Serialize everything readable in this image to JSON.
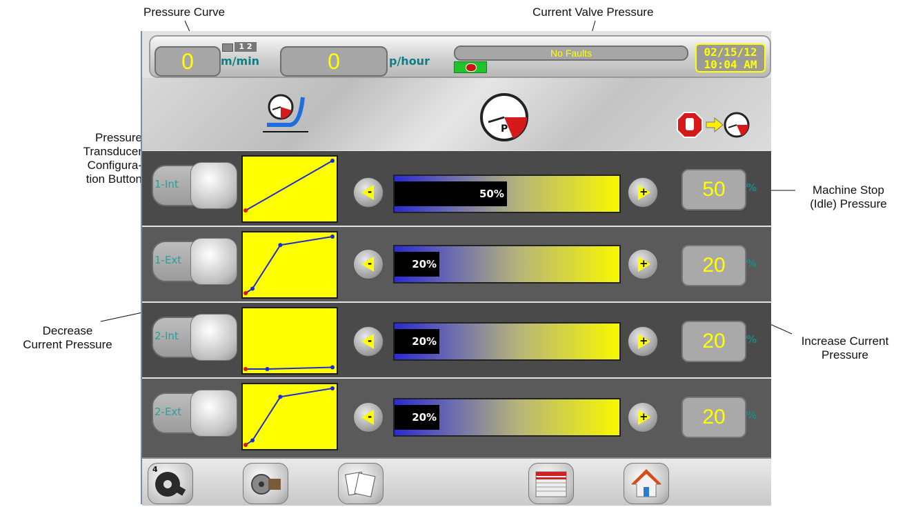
{
  "callouts": {
    "pressure_curve": "Pressure Curve",
    "current_valve_pressure": "Current Valve Pressure",
    "pressure_transducer": [
      "Pressure",
      "Transducer",
      "Configura-",
      "tion Button"
    ],
    "machine_stop": [
      "Machine Stop",
      "(Idle) Pressure"
    ],
    "decrease": [
      "Decrease",
      "Current Pressure"
    ],
    "increase": [
      "Increase Current",
      "Pressure"
    ]
  },
  "header": {
    "speed_value": "0",
    "speed_unit": "m/min",
    "line_indicator": "1 2",
    "rate_value": "0",
    "rate_unit": "p/hour",
    "fault_text": "No Faults",
    "date": "02/15/12",
    "time": "10:04 AM"
  },
  "column_icons": {
    "curve": "pressure-curve-icon",
    "gauge": "pressure-gauge-icon",
    "stop": "stop-to-gauge-icon"
  },
  "rows": [
    {
      "label": "1-Int",
      "percent": 50,
      "percent_label": "50%",
      "idle_value": "50",
      "idle_unit": "%",
      "curve_points": [
        [
          0,
          0.12
        ],
        [
          1,
          1.0
        ]
      ]
    },
    {
      "label": "1-Ext",
      "percent": 20,
      "percent_label": "20%",
      "idle_value": "20",
      "idle_unit": "%",
      "curve_points": [
        [
          0,
          0.0
        ],
        [
          0.08,
          0.08
        ],
        [
          0.4,
          0.85
        ],
        [
          1,
          1.0
        ]
      ]
    },
    {
      "label": "2-Int",
      "percent": 20,
      "percent_label": "20%",
      "idle_value": "20",
      "idle_unit": "%",
      "curve_points": [
        [
          0,
          0.0
        ],
        [
          0.25,
          0.0
        ],
        [
          1,
          0.03
        ]
      ]
    },
    {
      "label": "2-Ext",
      "percent": 20,
      "percent_label": "20%",
      "idle_value": "20",
      "idle_unit": "%",
      "curve_points": [
        [
          0,
          0.0
        ],
        [
          0.08,
          0.08
        ],
        [
          0.4,
          0.85
        ],
        [
          1,
          1.0
        ]
      ]
    }
  ],
  "footer": {
    "badge": "4",
    "buttons": [
      "wrench-config-icon",
      "motor-icon",
      "pages-icon",
      "log-list-icon",
      "home-icon"
    ]
  },
  "colors": {
    "accent_yellow": "#ffff00",
    "teal_text": "#0b7f84",
    "bar_start": "#2a2ad4",
    "bar_end": "#f8f800"
  }
}
